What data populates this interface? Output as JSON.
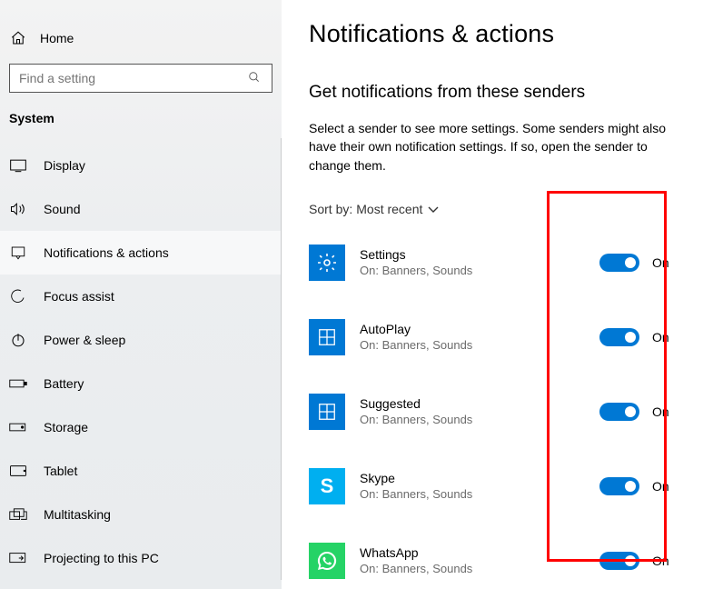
{
  "sidebar": {
    "home": "Home",
    "search_placeholder": "Find a setting",
    "group": "System",
    "items": [
      {
        "label": "Display"
      },
      {
        "label": "Sound"
      },
      {
        "label": "Notifications & actions"
      },
      {
        "label": "Focus assist"
      },
      {
        "label": "Power & sleep"
      },
      {
        "label": "Battery"
      },
      {
        "label": "Storage"
      },
      {
        "label": "Tablet"
      },
      {
        "label": "Multitasking"
      },
      {
        "label": "Projecting to this PC"
      }
    ]
  },
  "main": {
    "title": "Notifications & actions",
    "section_title": "Get notifications from these senders",
    "section_desc": "Select a sender to see more settings. Some senders might also have their own notification settings. If so, open the sender to change them.",
    "sort_label": "Sort by:",
    "sort_value": "Most recent",
    "senders": [
      {
        "name": "Settings",
        "sub": "On: Banners, Sounds",
        "toggle": "On",
        "kind": "settings"
      },
      {
        "name": "AutoPlay",
        "sub": "On: Banners, Sounds",
        "toggle": "On",
        "kind": "window"
      },
      {
        "name": "Suggested",
        "sub": "On: Banners, Sounds",
        "toggle": "On",
        "kind": "window"
      },
      {
        "name": "Skype",
        "sub": "On: Banners, Sounds",
        "toggle": "On",
        "kind": "skype"
      },
      {
        "name": "WhatsApp",
        "sub": "On: Banners, Sounds",
        "toggle": "On",
        "kind": "whatsapp"
      }
    ]
  }
}
